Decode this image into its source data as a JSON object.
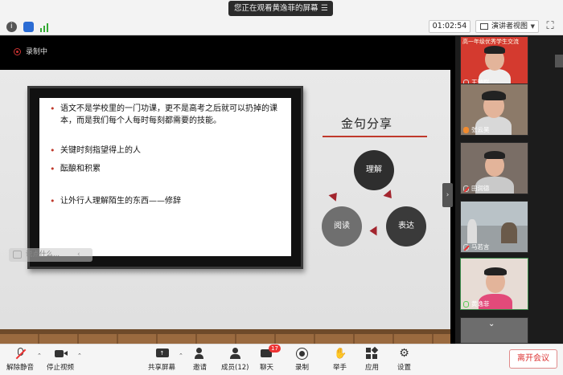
{
  "banner": {
    "text": "您正在观看黄逸菲的屏幕",
    "menu_icon": "menu-icon"
  },
  "toolbar_top": {
    "timer": "01:02:54",
    "view_label": "演讲者视图"
  },
  "recording": {
    "label": "录制中"
  },
  "slide": {
    "bullets": [
      "语文不是学校里的一门功课，更不是高考之后就可以扔掉的课本，而是我们每个人每时每刻都需要的技能。",
      "关键时刻指望得上的人",
      "酝酿和积累",
      "让外行人理解陌生的东西——修辞"
    ],
    "title": "金句分享",
    "cycle": [
      "理解",
      "表达",
      "阅读"
    ],
    "colors": {
      "dark": "#2e2e2e",
      "darker": "#3a3a3a",
      "grey": "#6f6f6f",
      "arrow": "#a3252e",
      "accent": "#c0392b"
    }
  },
  "chat": {
    "placeholder": "说点什么..."
  },
  "participants": [
    {
      "name": "王瑞群",
      "top_text": "高一年级优秀学生交流"
    },
    {
      "name": "张云昊"
    },
    {
      "name": "田润德"
    },
    {
      "name": "马若言"
    },
    {
      "name": "黄逸菲"
    },
    {
      "name": ""
    }
  ],
  "bottom": {
    "unmute": "解除静音",
    "stop_video": "停止视频",
    "share": "共享屏幕",
    "invite": "邀请",
    "members": "成员(12)",
    "chat": "聊天",
    "chat_badge": "17",
    "record": "录制",
    "raise_hand": "举手",
    "apps": "应用",
    "settings": "设置",
    "leave": "离开会议"
  }
}
